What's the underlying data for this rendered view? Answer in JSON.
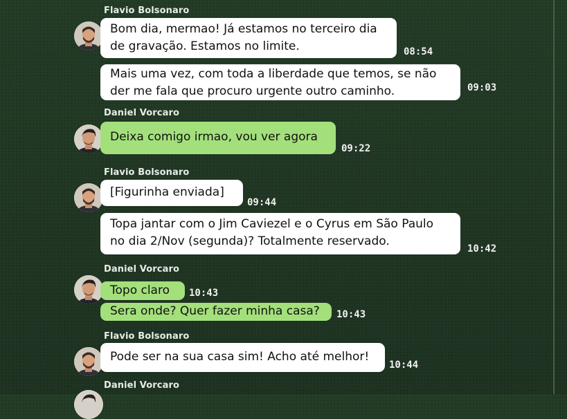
{
  "chat": {
    "groups": [
      {
        "sender": "Flavio Bolsonaro",
        "messages": [
          {
            "lines": [
              "Bom dia, mermao! Já estamos no terceiro dia",
              "de gravação. Estamos no limite."
            ],
            "time": "08:54"
          },
          {
            "lines": [
              "Mais uma vez, com toda a liberdade que temos, se não",
              "der me fala que procuro urgente outro caminho."
            ],
            "time": "09:03"
          }
        ]
      },
      {
        "sender": "Daniel Vorcaro",
        "messages": [
          {
            "lines": [
              "Deixa comigo irmao, vou ver agora"
            ],
            "time": "09:22"
          }
        ]
      },
      {
        "sender": "Flavio Bolsonaro",
        "messages": [
          {
            "lines": [
              "[Figurinha enviada]"
            ],
            "time": "09:44"
          },
          {
            "lines": [
              "Topa jantar com o Jim Caviezel e o Cyrus em São Paulo",
              "no dia 2/Nov (segunda)? Totalmente reservado."
            ],
            "time": "10:42"
          }
        ]
      },
      {
        "sender": "Daniel Vorcaro",
        "messages": [
          {
            "lines": [
              "Topo claro"
            ],
            "time": "10:43"
          },
          {
            "lines": [
              "Sera onde? Quer fazer minha casa?"
            ],
            "time": "10:43"
          }
        ]
      },
      {
        "sender": "Flavio Bolsonaro",
        "messages": [
          {
            "lines": [
              "Pode ser na sua casa sim! Acho até melhor!"
            ],
            "time": "10:44"
          }
        ]
      },
      {
        "sender": "Daniel Vorcaro",
        "messages": []
      }
    ]
  },
  "colors": {
    "background": "#1f3522",
    "bubble_white": "#ffffff",
    "bubble_green": "#a3e07c",
    "text": "#111111",
    "meta_text": "#f1f1f1"
  },
  "icons": {
    "flavio_avatar": "avatar-photo-man-beard",
    "daniel_avatar": "avatar-photo-man-dark-hair"
  }
}
